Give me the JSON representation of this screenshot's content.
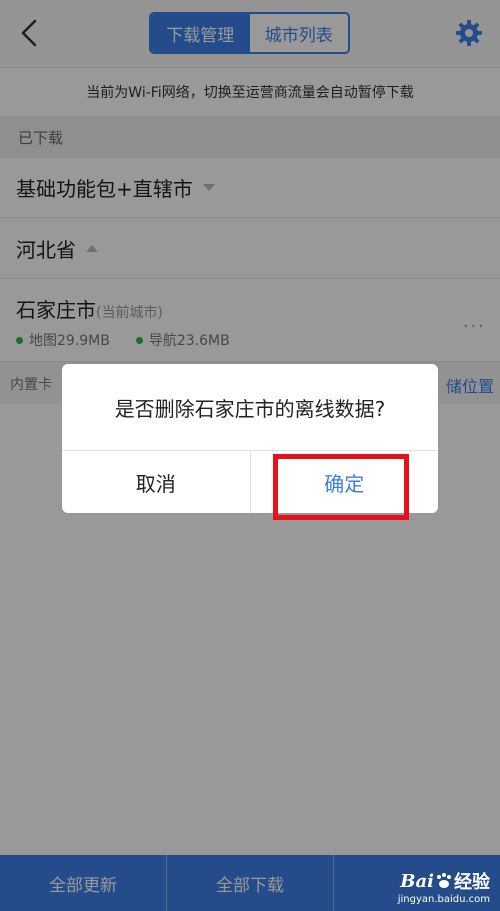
{
  "header": {
    "tabs": [
      {
        "label": "下载管理",
        "active": true
      },
      {
        "label": "城市列表",
        "active": false
      }
    ]
  },
  "notice": "当前为Wi-Fi网络，切换至运营商流量会自动暂停下载",
  "section_title": "已下载",
  "groups": [
    {
      "name": "基础功能包+直辖市",
      "expanded": false
    },
    {
      "name": "河北省",
      "expanded": true
    }
  ],
  "city": {
    "name": "石家庄市",
    "tag": "(当前城市)",
    "map_size": "地图29.9MB",
    "nav_size": "导航23.6MB",
    "more": "···"
  },
  "storage": {
    "left_label": "内置卡",
    "right_label": "储位置"
  },
  "bottom_bar": {
    "update_all": "全部更新",
    "download_all": "全部下载",
    "third": ""
  },
  "dialog": {
    "message": "是否删除石家庄市的离线数据?",
    "cancel": "取消",
    "confirm": "确定"
  },
  "watermark": {
    "logo": "Bai",
    "logo_suffix": "经验",
    "site": "jingyan.baidu.com"
  },
  "colors": {
    "accent": "#3d7fe6",
    "highlight": "#e8101a",
    "status_dot": "#38b24a"
  }
}
